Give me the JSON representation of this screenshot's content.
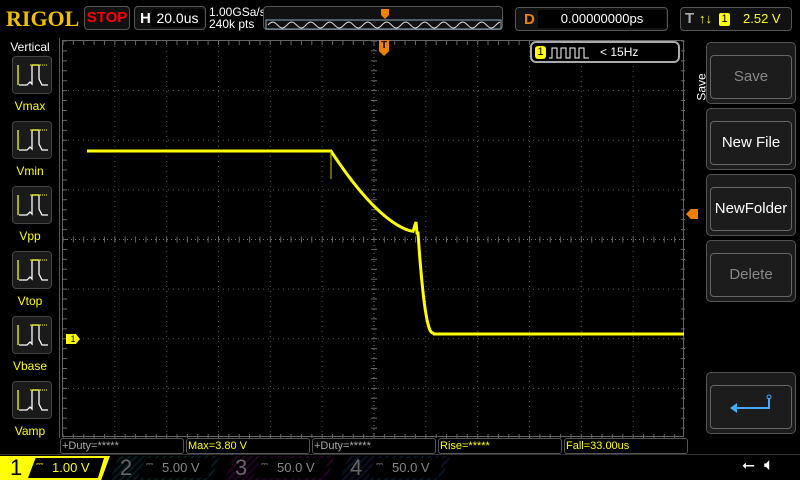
{
  "header": {
    "logo": "RIGOL",
    "run_state": "STOP",
    "h_label": "H",
    "timebase": "20.0us",
    "sample_rate": "1.00GSa/s",
    "memory_depth": "240k pts",
    "d_label": "D",
    "delay": "0.00000000ps",
    "t_label": "T",
    "trigger_edge": "rise-fall-icon",
    "trigger_source": "1",
    "trigger_level": "2.52 V"
  },
  "left_menu": {
    "title": "Vertical",
    "items": [
      {
        "label": "Vmax"
      },
      {
        "label": "Vmin"
      },
      {
        "label": "Vpp"
      },
      {
        "label": "Vtop"
      },
      {
        "label": "Vbase"
      },
      {
        "label": "Vamp"
      }
    ]
  },
  "freq_badge": {
    "channel": "1",
    "text": "< 15Hz"
  },
  "markers": {
    "trigger_pos": "T",
    "ch1_ground": "1"
  },
  "right_menu": {
    "title": "Save",
    "items": [
      {
        "label": "Save",
        "enabled": false
      },
      {
        "label": "New File",
        "enabled": true
      },
      {
        "label": "NewFolder",
        "enabled": true
      },
      {
        "label": "Delete",
        "enabled": false
      }
    ],
    "back_icon": "return-arrow-icon"
  },
  "measurements": [
    "+Duty=*****",
    "Max=3.80 V",
    "+Duty=*****",
    "Rise=*****",
    "Fall=33.00us"
  ],
  "channels": [
    {
      "num": "1",
      "scale": "1.00 V",
      "color": "#ffff00",
      "active": true
    },
    {
      "num": "2",
      "scale": "5.00 V",
      "color": "#00a0a0",
      "active": false
    },
    {
      "num": "3",
      "scale": "50.0 V",
      "color": "#c000c0",
      "active": false
    },
    {
      "num": "4",
      "scale": "50.0 V",
      "color": "#2060c0",
      "active": false
    }
  ],
  "status_icons": [
    "usb-icon",
    "speaker-muted-icon"
  ],
  "colors": {
    "ch1": "#ffff00",
    "trigger": "#f08000",
    "stop": "#ff0000"
  }
}
